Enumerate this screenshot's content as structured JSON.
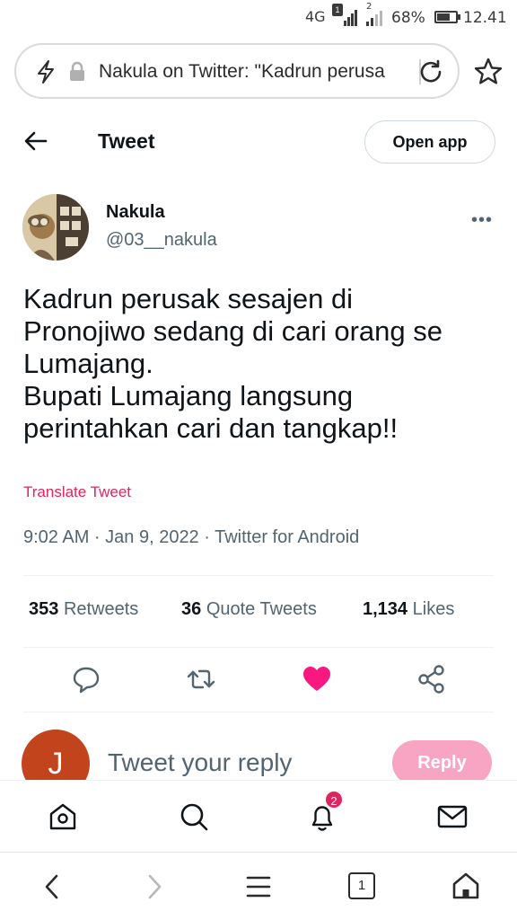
{
  "status_bar": {
    "network": "4G",
    "sim1_badge": "1",
    "sim2_badge": "2",
    "battery": "68%",
    "battery_level": 0.68,
    "time": "12.41"
  },
  "browser": {
    "url_text": "Nakula on Twitter: \"Kadrun perusa"
  },
  "header": {
    "title": "Tweet",
    "open_app_label": "Open app"
  },
  "tweet": {
    "author_name": "Nakula",
    "author_handle": "@03__nakula",
    "more_label": "•••",
    "body_lines": [
      "Kadrun perusak sesajen di",
      "Pronojiwo sedang di cari orang se",
      "Lumajang.",
      "Bupati Lumajang langsung",
      "perintahkan cari dan tangkap!!"
    ],
    "translate_label": "Translate Tweet",
    "meta": "9:02 AM · Jan 9, 2022 · Twitter for Android"
  },
  "stats": {
    "retweets_count": "353",
    "retweets_label": "Retweets",
    "quote_count": "36",
    "quote_label": "Quote Tweets",
    "likes_count": "1,134",
    "likes_label": "Likes"
  },
  "reply": {
    "avatar_letter": "J",
    "placeholder": "Tweet your reply",
    "button_label": "Reply"
  },
  "bottom_nav": {
    "notifications_badge": "2"
  },
  "browser_bar": {
    "tabs_count": "1"
  },
  "colors": {
    "like_pink": "#f91880",
    "accent_pink": "#e0245e",
    "reply_button": "#f7a5c3",
    "reply_avatar": "#c1441c",
    "secondary_text": "#536471"
  }
}
